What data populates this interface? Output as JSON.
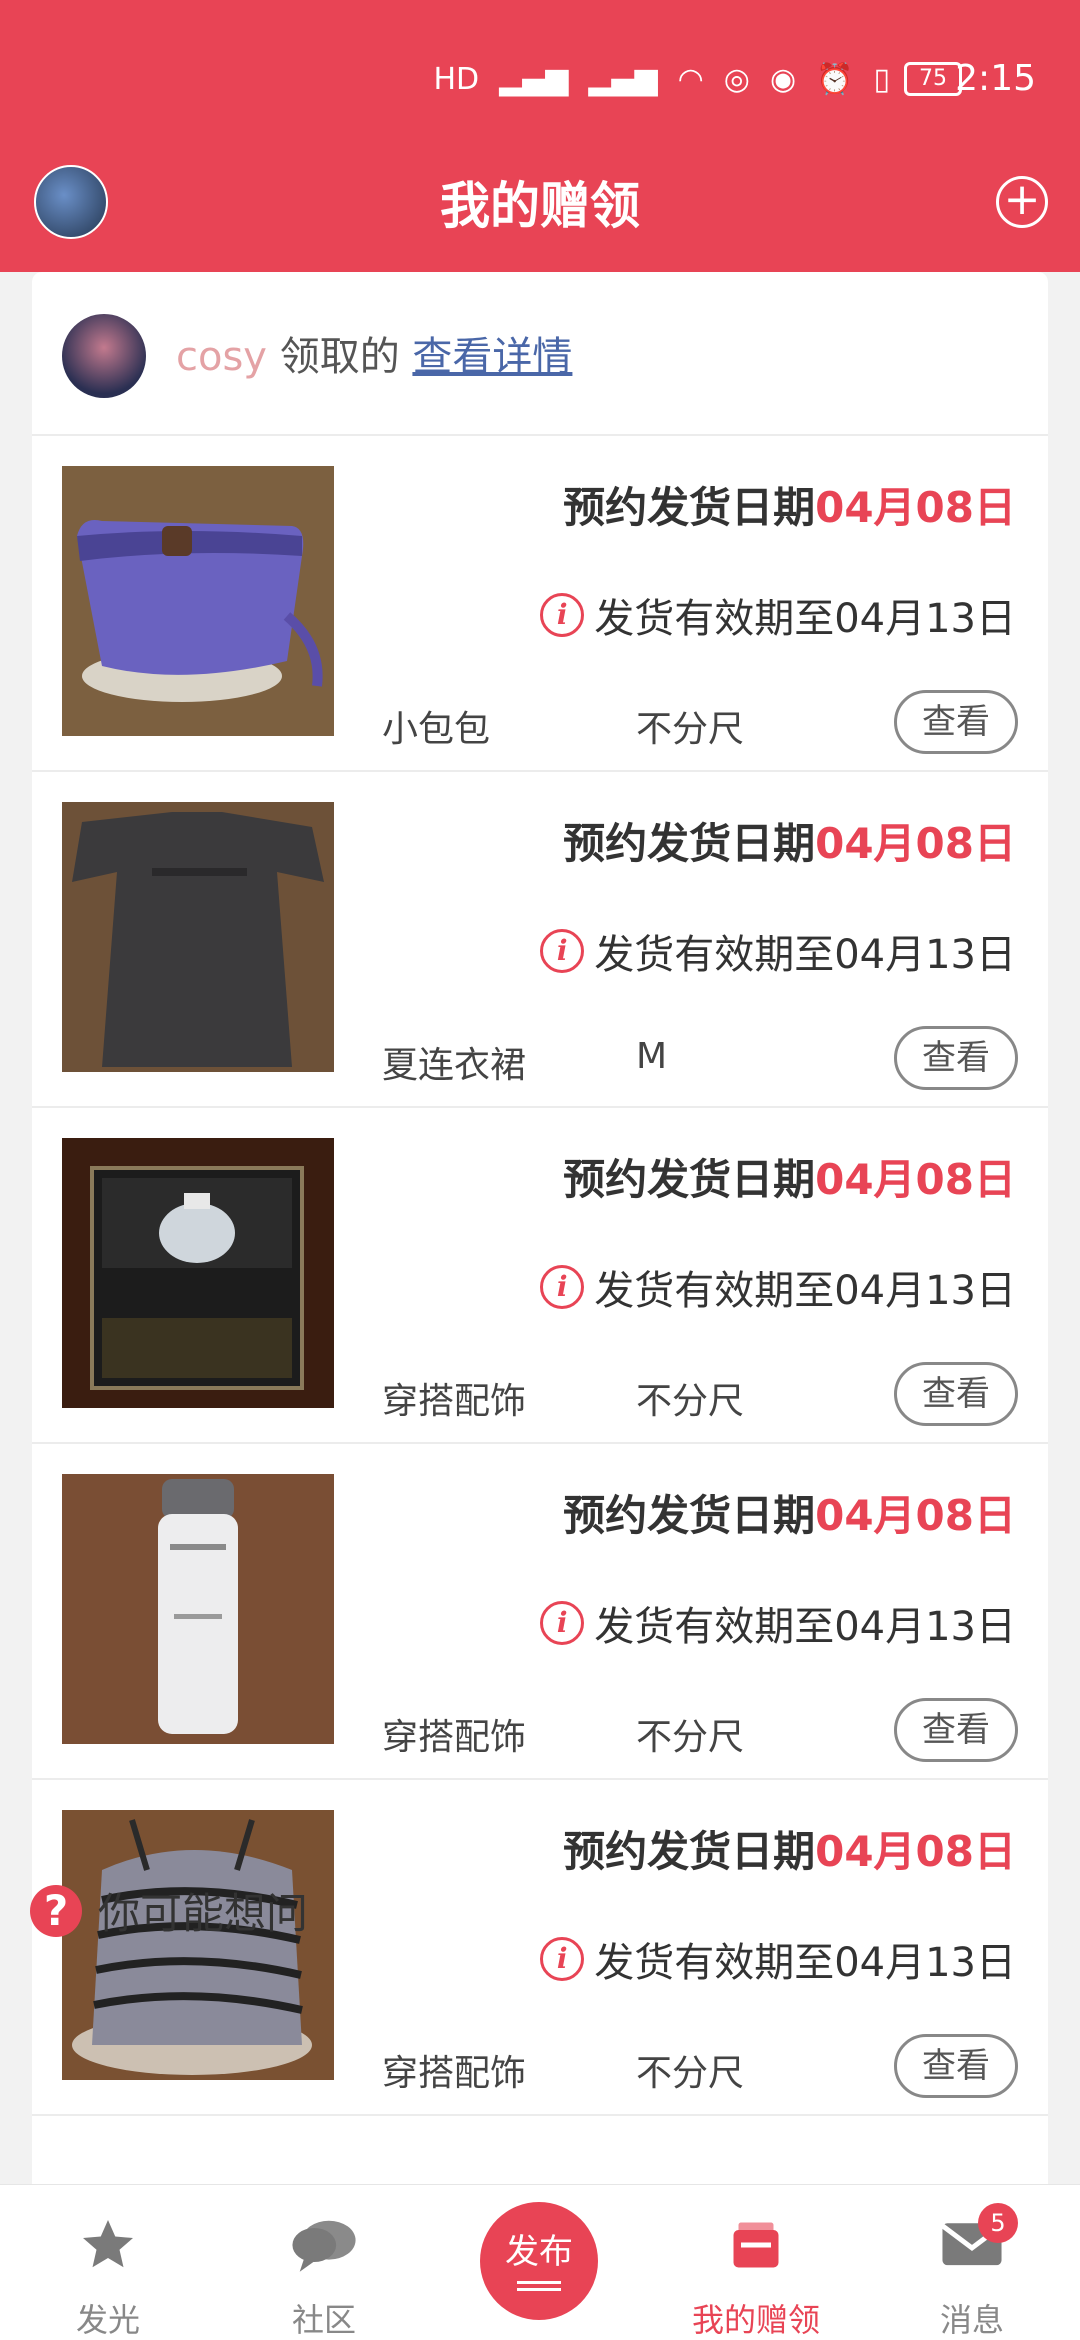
{
  "status_bar": {
    "icons": [
      "hd-icon",
      "signal-icon",
      "signal-icon",
      "wifi-icon",
      "nfc-icon",
      "eye-icon",
      "alarm-icon",
      "vibrate-icon"
    ],
    "battery": "75",
    "time": "2:15"
  },
  "header": {
    "title": "我的赠领"
  },
  "claim": {
    "user": "cosy",
    "middle": " 领取的 ",
    "link": "查看详情"
  },
  "items": [
    {
      "date_label": "预约发货日期",
      "date_value": "04月08日",
      "valid": "发货有效期至04月13日",
      "name": "小包包",
      "size": "不分尺",
      "button": "查看"
    },
    {
      "date_label": "预约发货日期",
      "date_value": "04月08日",
      "valid": "发货有效期至04月13日",
      "name": "夏连衣裙",
      "size": "M",
      "button": "查看"
    },
    {
      "date_label": "预约发货日期",
      "date_value": "04月08日",
      "valid": "发货有效期至04月13日",
      "name": "穿搭配饰",
      "size": "不分尺",
      "button": "查看"
    },
    {
      "date_label": "预约发货日期",
      "date_value": "04月08日",
      "valid": "发货有效期至04月13日",
      "name": "穿搭配饰",
      "size": "不分尺",
      "button": "查看"
    },
    {
      "date_label": "预约发货日期",
      "date_value": "04月08日",
      "valid": "发货有效期至04月13日",
      "name": "穿搭配饰",
      "size": "不分尺",
      "button": "查看"
    }
  ],
  "maybe": {
    "label": "你可能想问"
  },
  "nav": {
    "items": [
      {
        "label": "发光",
        "icon": "star-icon"
      },
      {
        "label": "社区",
        "icon": "chat-icon"
      },
      {
        "label": "发布",
        "icon": "publish-icon"
      },
      {
        "label": "我的赠领",
        "icon": "gift-box-icon"
      },
      {
        "label": "消息",
        "icon": "mail-icon"
      }
    ],
    "badge": "5"
  },
  "colors": {
    "accent": "#e84455",
    "link": "#4a67a8",
    "user": "#e4a2a5"
  }
}
